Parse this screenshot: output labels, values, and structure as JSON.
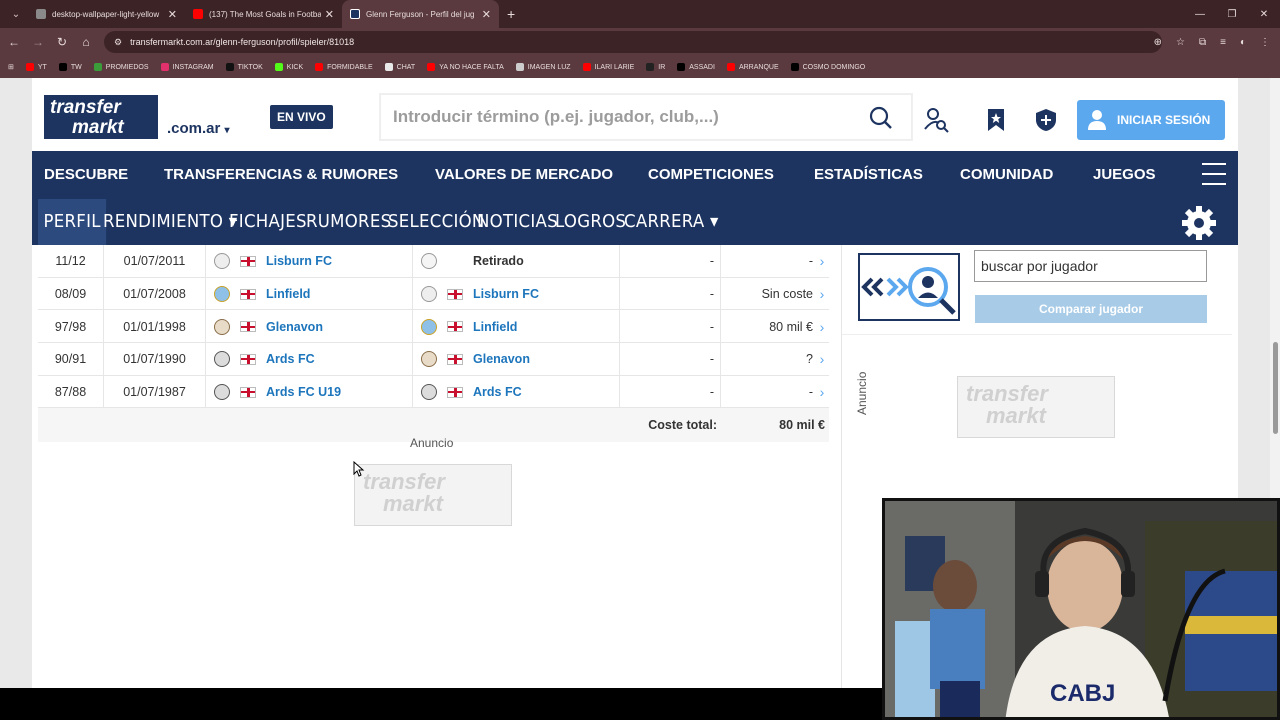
{
  "browser": {
    "tabs": [
      {
        "title": "desktop-wallpaper-light-yellow",
        "color": "#8a8a8a"
      },
      {
        "title": "(137) The Most Goals in Footba",
        "color": "#ff0000"
      },
      {
        "title": "Glenn Ferguson - Perfil del jug",
        "color": "#1d3461"
      }
    ],
    "url": "transfermarkt.com.ar/glenn-ferguson/profil/spieler/81018",
    "bookmarks": [
      {
        "label": "YT",
        "color": "#ff0000"
      },
      {
        "label": "TW",
        "color": "#000000"
      },
      {
        "label": "PROMIEDOS",
        "color": "#3a9d3a"
      },
      {
        "label": "INSTAGRAM",
        "color": "#e1306c"
      },
      {
        "label": "TIKTOK",
        "color": "#111111"
      },
      {
        "label": "KICK",
        "color": "#53fc18"
      },
      {
        "label": "FORMIDABLE",
        "color": "#ff0000"
      },
      {
        "label": "CHAT",
        "color": "#e8e8e8"
      },
      {
        "label": "YA NO HACE FALTA",
        "color": "#ff0000"
      },
      {
        "label": "IMAGEN LUZ",
        "color": "#cccccc"
      },
      {
        "label": "ILARI LARIE",
        "color": "#ff0000"
      },
      {
        "label": "IR",
        "color": "#222222"
      },
      {
        "label": "ASSADI",
        "color": "#000000"
      },
      {
        "label": "ARRANQUE",
        "color": "#ff0000"
      },
      {
        "label": "COSMO DOMINGO",
        "color": "#000000"
      }
    ]
  },
  "header": {
    "logo_top": "transfer",
    "logo_bottom": "markt",
    "domain": ".com.ar",
    "live": "EN VIVO",
    "search_placeholder": "Introducir término (p.ej. jugador, club,...)",
    "login": "INICIAR SESIÓN"
  },
  "main_nav": [
    {
      "label": "DESCUBRE"
    },
    {
      "label": "TRANSFERENCIAS & RUMORES"
    },
    {
      "label": "VALORES DE MERCADO"
    },
    {
      "label": "COMPETICIONES"
    },
    {
      "label": "ESTADÍSTICAS"
    },
    {
      "label": "COMUNIDAD"
    },
    {
      "label": "JUEGOS"
    }
  ],
  "sub_nav": [
    {
      "label": "PERFIL"
    },
    {
      "label": "RENDIMIENTO ▾"
    },
    {
      "label": "FICHAJES"
    },
    {
      "label": "RUMORES"
    },
    {
      "label": "SELECCIÓN"
    },
    {
      "label": "NOTICIAS"
    },
    {
      "label": "LOGROS"
    },
    {
      "label": "CARRERA ▾"
    }
  ],
  "transfers": [
    {
      "season": "11/12",
      "date": "01/07/2011",
      "from": "Lisburn FC",
      "to": "Retirado",
      "mv": "-",
      "fee": "-"
    },
    {
      "season": "08/09",
      "date": "01/07/2008",
      "from": "Linfield",
      "to": "Lisburn FC",
      "mv": "-",
      "fee": "Sin coste"
    },
    {
      "season": "97/98",
      "date": "01/01/1998",
      "from": "Glenavon",
      "to": "Linfield",
      "mv": "-",
      "fee": "80 mil €"
    },
    {
      "season": "90/91",
      "date": "01/07/1990",
      "from": "Ards FC",
      "to": "Glenavon",
      "mv": "-",
      "fee": "?"
    },
    {
      "season": "87/88",
      "date": "01/07/1987",
      "from": "Ards FC U19",
      "to": "Ards FC",
      "mv": "-",
      "fee": "-"
    }
  ],
  "total": {
    "label": "Coste total:",
    "value": "80 mil €"
  },
  "ad": {
    "label": "Anuncio",
    "logo_top": "transfer",
    "logo_bottom": "markt"
  },
  "compare": {
    "input_value": "buscar por jugador",
    "button": "Comparar jugador"
  },
  "side_ad": {
    "label": "Anuncio"
  }
}
